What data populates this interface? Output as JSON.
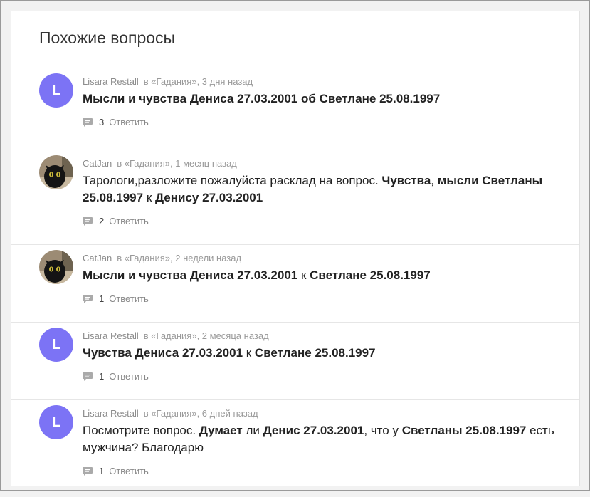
{
  "section": {
    "title": "Похожие вопросы"
  },
  "reply_label": "Ответить",
  "colors": {
    "avatar_bg": "#7c73f5"
  },
  "items": [
    {
      "avatar": {
        "type": "letter",
        "letter": "L"
      },
      "user": "Lisara Restall",
      "meta": "в «Гадания», 3 дня назад",
      "question": [
        {
          "t": "Мысли и чувства Дениса 27.03.2001 об Светлане 25.08.1997",
          "b": true
        }
      ],
      "count": "3"
    },
    {
      "avatar": {
        "type": "photo",
        "icon": "black-cat-photo"
      },
      "user": "CatJan",
      "meta": "в «Гадания», 1 месяц назад",
      "question": [
        {
          "t": "Тарологи,разложите пожалуйста расклад на вопрос. ",
          "b": false
        },
        {
          "t": "Чувства",
          "b": true
        },
        {
          "t": ", ",
          "b": false
        },
        {
          "t": "мысли Светланы 25.08.1997",
          "b": true
        },
        {
          "t": " к ",
          "b": false
        },
        {
          "t": "Денису 27.03.2001",
          "b": true
        }
      ],
      "count": "2"
    },
    {
      "avatar": {
        "type": "photo",
        "icon": "black-cat-photo"
      },
      "user": "CatJan",
      "meta": "в «Гадания», 2 недели назад",
      "question": [
        {
          "t": "Мысли и чувства Дениса 27.03.2001",
          "b": true
        },
        {
          "t": " к ",
          "b": false
        },
        {
          "t": "Светлане 25.08.1997",
          "b": true
        }
      ],
      "count": "1"
    },
    {
      "avatar": {
        "type": "letter",
        "letter": "L"
      },
      "user": "Lisara Restall",
      "meta": "в «Гадания», 2 месяца назад",
      "question": [
        {
          "t": "Чувства Дениса 27.03.2001",
          "b": true
        },
        {
          "t": " к ",
          "b": false
        },
        {
          "t": "Светлане 25.08.1997",
          "b": true
        }
      ],
      "count": "1"
    },
    {
      "avatar": {
        "type": "letter",
        "letter": "L"
      },
      "user": "Lisara Restall",
      "meta": "в «Гадания», 6 дней назад",
      "question": [
        {
          "t": "Посмотрите вопрос. ",
          "b": false
        },
        {
          "t": "Думает",
          "b": true
        },
        {
          "t": " ли ",
          "b": false
        },
        {
          "t": "Денис 27.03.2001",
          "b": true
        },
        {
          "t": ", что у ",
          "b": false
        },
        {
          "t": "Светланы 25.08.1997",
          "b": true
        },
        {
          "t": " есть мужчина? Благодарю",
          "b": false
        }
      ],
      "count": "1"
    }
  ]
}
